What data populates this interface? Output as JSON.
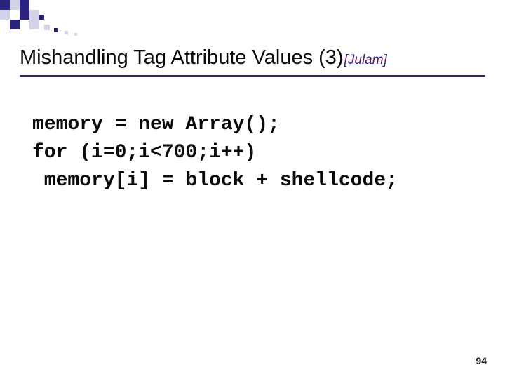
{
  "slide": {
    "title_main": "Mishandling Tag Attribute Values (3)",
    "title_sub": "[Julam]",
    "page_number": "94"
  },
  "code": {
    "line1": "memory = new Array();",
    "line2": "for (i=0;i<700;i++)",
    "line3": " memory[i] = block + shellcode;"
  }
}
